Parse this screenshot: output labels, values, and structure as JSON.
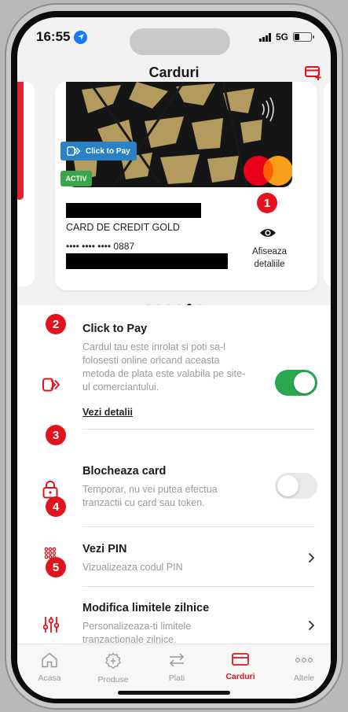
{
  "status_bar": {
    "time": "16:55",
    "network": "5G"
  },
  "header": {
    "title": "Carduri"
  },
  "card": {
    "click_to_pay_badge": "Click to Pay",
    "active_badge": "ACTIV",
    "name": "CARD DE CREDIT GOLD",
    "number": "•••• •••• •••• 0887",
    "details_label_line1": "Afiseaza",
    "details_label_line2": "detaliile"
  },
  "carousel": {
    "page_count": 6,
    "active_index": 4
  },
  "annotations": [
    "1",
    "2",
    "3",
    "4",
    "5"
  ],
  "settings": {
    "click_to_pay": {
      "title": "Click to Pay",
      "desc_lines": [
        "Cardul tau este inrolat si poti sa-l",
        "folosesti online oricand aceasta",
        "metoda de plata este valabila pe site-",
        "ul comerciantului."
      ],
      "link": "Vezi detalii",
      "enabled": true
    },
    "block_card": {
      "title": "Blocheaza card",
      "desc_lines": [
        "Temporar, nu vei putea efectua",
        "tranzactii cu card sau token."
      ],
      "enabled": false
    },
    "view_pin": {
      "title": "Vezi PIN",
      "desc": "Vizualizeaza codul PIN"
    },
    "daily_limits": {
      "title": "Modifica limitele zilnice",
      "desc_lines": [
        "Personalizeaza-ti limitele",
        "tranzactionale zilnice."
      ]
    }
  },
  "tabbar": {
    "tabs": [
      {
        "label": "Acasa"
      },
      {
        "label": "Produse"
      },
      {
        "label": "Plati"
      },
      {
        "label": "Carduri"
      },
      {
        "label": "Altele"
      }
    ],
    "active": "Carduri"
  },
  "colors": {
    "accent": "#e1141e",
    "toggle_on": "#2aa84e",
    "toggle_off": "#e9e9eb"
  }
}
